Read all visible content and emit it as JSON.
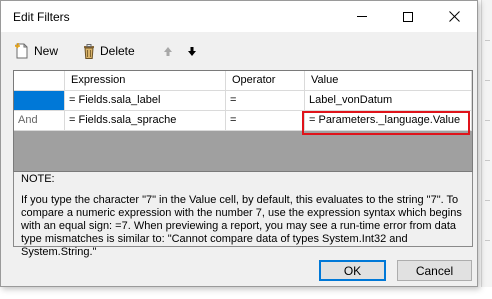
{
  "window": {
    "title": "Edit Filters"
  },
  "toolbar": {
    "new_label": "New",
    "delete_label": "Delete"
  },
  "grid": {
    "columns": [
      "",
      "Expression",
      "Operator",
      "Value"
    ],
    "rows": [
      {
        "connector": "",
        "expression": "= Fields.sala_label",
        "operator": "=",
        "value": "Label_vonDatum"
      },
      {
        "connector": "And",
        "expression": "= Fields.sala_sprache",
        "operator": "=",
        "value": "= Parameters._language.Value"
      }
    ]
  },
  "note": {
    "title": "NOTE:",
    "text": "If you type the character \"7\" in the Value cell, by default, this evaluates to the string \"7\". To compare a numeric expression with the number 7, use the expression syntax which begins with an equal sign: =7. When previewing a report, you may see a run-time error from data type mismatches is similar to: \"Cannot compare data of types System.Int32 and System.String.\""
  },
  "buttons": {
    "ok": "OK",
    "cancel": "Cancel"
  },
  "icons": {
    "new": "new-file-icon",
    "delete": "trash-icon",
    "move_up": "arrow-up-icon",
    "move_down": "arrow-down-icon",
    "minimize": "minimize-icon",
    "maximize": "maximize-icon",
    "close": "close-icon"
  },
  "colors": {
    "selection": "#0078d7",
    "highlight_box": "#e0131a",
    "grid_empty": "#a0a0a0",
    "dialog_bg": "#f0f0f0"
  }
}
